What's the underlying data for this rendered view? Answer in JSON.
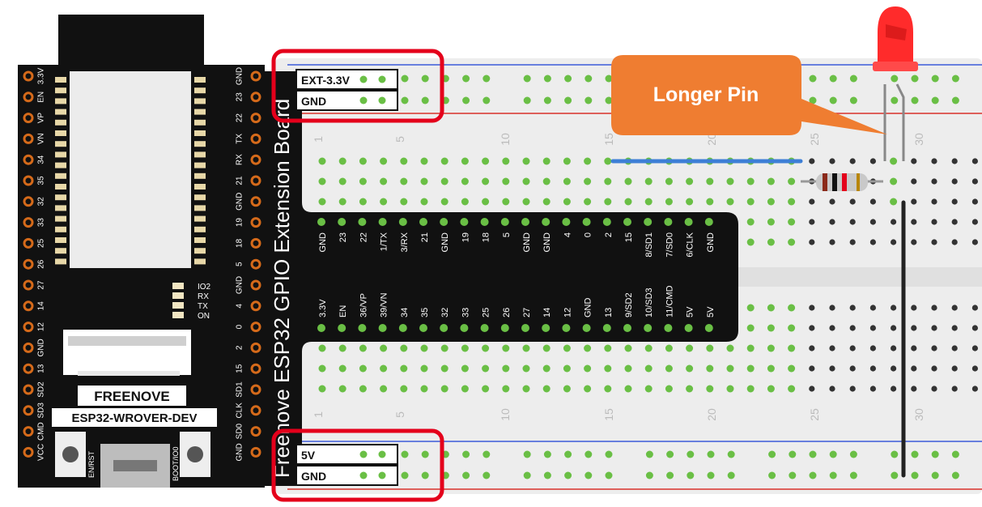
{
  "extension_board": {
    "title": "Freenove ESP32 GPIO Extension Board",
    "top_rail": [
      {
        "label": "EXT-3.3V"
      },
      {
        "label": "GND"
      }
    ],
    "bottom_rail": [
      {
        "label": "5V"
      },
      {
        "label": "GND"
      }
    ],
    "header_top": [
      "GND",
      "23",
      "22",
      "1/TX",
      "3/RX",
      "21",
      "GND",
      "19",
      "18",
      "5",
      "GND",
      "GND",
      "4",
      "0",
      "2",
      "15",
      "8/SD1",
      "7/SD0",
      "6/CLK",
      "GND"
    ],
    "header_bottom": [
      "3.3V",
      "EN",
      "36/VP",
      "39/VN",
      "34",
      "35",
      "32",
      "33",
      "25",
      "26",
      "27",
      "14",
      "12",
      "GND",
      "13",
      "9/SD2",
      "10/SD3",
      "11/CMD",
      "5V",
      "5V"
    ]
  },
  "esp32_board": {
    "brand": "FREENOVE",
    "model": "ESP32-WROVER-DEV",
    "left_pins": [
      "3.3V",
      "EN",
      "VP",
      "VN",
      "34",
      "35",
      "32",
      "33",
      "25",
      "26",
      "27",
      "14",
      "12",
      "GND",
      "13",
      "SD2",
      "SD3",
      "CMD",
      "VCC"
    ],
    "right_pins": [
      "GND",
      "23",
      "22",
      "TX",
      "RX",
      "21",
      "GND",
      "19",
      "18",
      "5",
      "GND",
      "4",
      "0",
      "2",
      "15",
      "SD1",
      "CLK",
      "SD0",
      "GND"
    ],
    "leds": [
      "IO2",
      "RX",
      "TX",
      "ON"
    ],
    "buttons": [
      "EN/RST",
      "BOOT/IO0"
    ]
  },
  "breadboard": {
    "column_numbers": [
      "1",
      "5",
      "10",
      "15",
      "20",
      "25",
      "30"
    ]
  },
  "callout": {
    "text": "Longer Pin"
  },
  "colors": {
    "highlight": "#e4001b",
    "callout": "#ef7d31",
    "board_black": "#111111",
    "pin_green": "#6abf45",
    "rail_blue": "#3d5bd9",
    "rail_red": "#d9322b",
    "led_red": "#ff2b2b",
    "wire_blue": "#3d7fd6",
    "wire_black": "#222222"
  }
}
